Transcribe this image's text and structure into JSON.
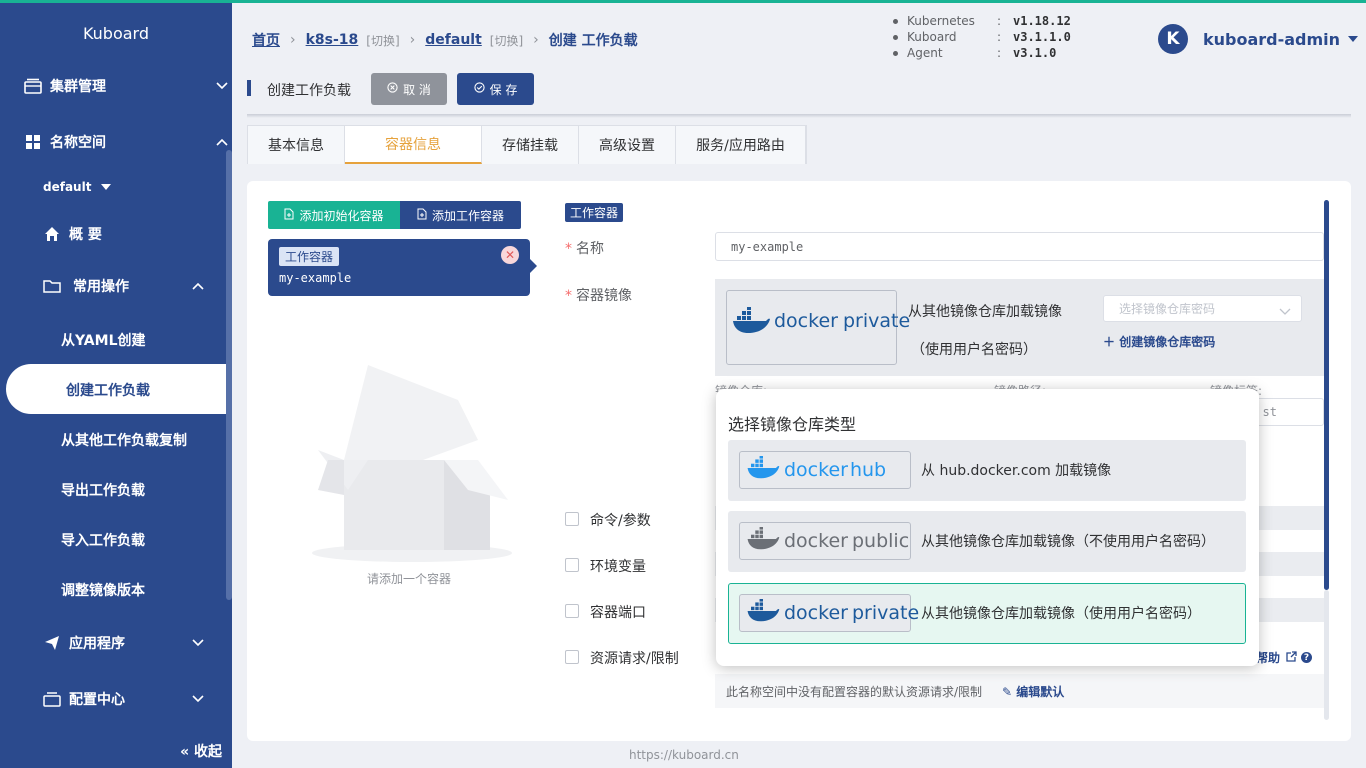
{
  "app": {
    "title": "Kuboard",
    "footer": "https://kuboard.cn"
  },
  "colors": {
    "accent": "#2b4a8d",
    "success": "#19b394",
    "warning": "#e6a23c",
    "danger": "#f56c6c"
  },
  "sidebar": {
    "cluster": "集群管理",
    "namespace": "名称空间",
    "ns_selected": "default",
    "overview": "概 要",
    "common_ops": "常用操作",
    "ops": [
      "从YAML创建",
      "创建工作负载",
      "从其他工作负载复制",
      "导出工作负载",
      "导入工作负载",
      "调整镜像版本"
    ],
    "apps": "应用程序",
    "config": "配置中心",
    "collapse": "收起"
  },
  "breadcrumb": {
    "home": "首页",
    "cluster": "k8s-18",
    "switch": "[切换]",
    "namespace": "default",
    "current": "创建 工作负载"
  },
  "versions": [
    {
      "name": "Kubernetes",
      "colon": ":",
      "value": "v1.18.12"
    },
    {
      "name": "Kuboard",
      "colon": ":",
      "value": "v3.1.1.0"
    },
    {
      "name": "Agent",
      "colon": ":",
      "value": "v3.1.0"
    }
  ],
  "user": {
    "initial": "K",
    "name": "kuboard-admin"
  },
  "actionbar": {
    "title": "创建工作负载",
    "cancel": "取 消",
    "save": "保 存"
  },
  "tabs": [
    "基本信息",
    "容器信息",
    "存储挂载",
    "高级设置",
    "服务/应用路由"
  ],
  "containers": {
    "add_init": "添加初始化容器",
    "add_work": "添加工作容器",
    "card_tag": "工作容器",
    "card_name": "my-example",
    "empty_text": "请添加一个容器"
  },
  "form": {
    "section_tag": "工作容器",
    "name_label": "名称",
    "name_value": "my-example",
    "image_label": "容器镜像",
    "image_from": "从其他镜像仓库加载镜像",
    "image_auth": "（使用用户名密码）",
    "secret_placeholder": "选择镜像仓库密码",
    "create_secret": "创建镜像仓库密码",
    "sub_labels": [
      "镜像仓库:",
      "镜像路径:",
      "镜像标签:"
    ],
    "tag_tail": "st",
    "checks": [
      "命令/参数",
      "环境变量",
      "容器端口",
      "资源请求/限制"
    ],
    "help": "帮助",
    "res_note": "此名称空间中没有配置容器的默认资源请求/限制",
    "edit_default": "编辑默认"
  },
  "popup": {
    "title": "选择镜像仓库类型",
    "options": [
      {
        "brand": "docker",
        "kind": "hub",
        "text": "从 hub.docker.com 加载镜像"
      },
      {
        "brand": "docker",
        "kind": "public",
        "text": "从其他镜像仓库加载镜像（不使用用户名密码）"
      },
      {
        "brand": "docker",
        "kind": "private",
        "text": "从其他镜像仓库加载镜像（使用用户名密码）"
      }
    ]
  },
  "image_logo": {
    "brand": "docker",
    "kind": "private"
  },
  "icons": [
    "server-icon",
    "grid-icon",
    "home-icon",
    "folder-icon",
    "send-icon",
    "config-icon",
    "chevron-down-icon",
    "chevron-up-icon",
    "cancel-icon",
    "save-icon",
    "file-add-icon",
    "close-icon",
    "plus-icon",
    "edit-icon",
    "external-link-icon",
    "question-icon",
    "docker-whale-icon"
  ]
}
